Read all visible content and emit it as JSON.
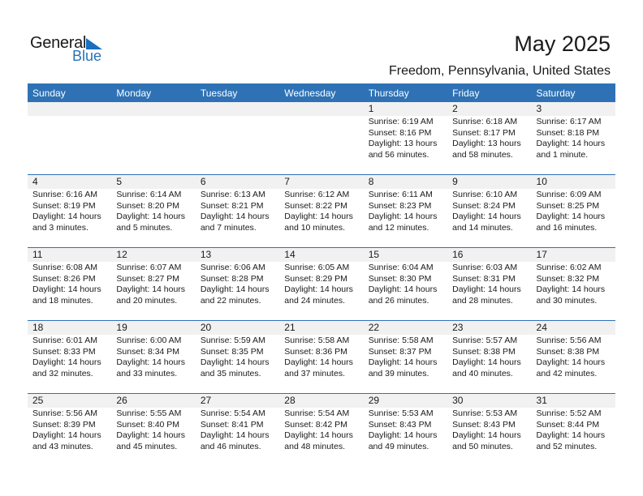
{
  "logo": {
    "word1": "General",
    "word2": "Blue"
  },
  "header": {
    "title": "May 2025",
    "location": "Freedom, Pennsylvania, United States"
  },
  "colors": {
    "header_bg": "#2e72b5",
    "daynum_bg": "#f1f1f1",
    "logo_blue": "#2a72b8"
  },
  "weekdays": [
    "Sunday",
    "Monday",
    "Tuesday",
    "Wednesday",
    "Thursday",
    "Friday",
    "Saturday"
  ],
  "weeks": [
    [
      null,
      null,
      null,
      null,
      {
        "day": "1",
        "sunrise": "Sunrise: 6:19 AM",
        "sunset": "Sunset: 8:16 PM",
        "daylight1": "Daylight: 13 hours",
        "daylight2": "and 56 minutes."
      },
      {
        "day": "2",
        "sunrise": "Sunrise: 6:18 AM",
        "sunset": "Sunset: 8:17 PM",
        "daylight1": "Daylight: 13 hours",
        "daylight2": "and 58 minutes."
      },
      {
        "day": "3",
        "sunrise": "Sunrise: 6:17 AM",
        "sunset": "Sunset: 8:18 PM",
        "daylight1": "Daylight: 14 hours",
        "daylight2": "and 1 minute."
      }
    ],
    [
      {
        "day": "4",
        "sunrise": "Sunrise: 6:16 AM",
        "sunset": "Sunset: 8:19 PM",
        "daylight1": "Daylight: 14 hours",
        "daylight2": "and 3 minutes."
      },
      {
        "day": "5",
        "sunrise": "Sunrise: 6:14 AM",
        "sunset": "Sunset: 8:20 PM",
        "daylight1": "Daylight: 14 hours",
        "daylight2": "and 5 minutes."
      },
      {
        "day": "6",
        "sunrise": "Sunrise: 6:13 AM",
        "sunset": "Sunset: 8:21 PM",
        "daylight1": "Daylight: 14 hours",
        "daylight2": "and 7 minutes."
      },
      {
        "day": "7",
        "sunrise": "Sunrise: 6:12 AM",
        "sunset": "Sunset: 8:22 PM",
        "daylight1": "Daylight: 14 hours",
        "daylight2": "and 10 minutes."
      },
      {
        "day": "8",
        "sunrise": "Sunrise: 6:11 AM",
        "sunset": "Sunset: 8:23 PM",
        "daylight1": "Daylight: 14 hours",
        "daylight2": "and 12 minutes."
      },
      {
        "day": "9",
        "sunrise": "Sunrise: 6:10 AM",
        "sunset": "Sunset: 8:24 PM",
        "daylight1": "Daylight: 14 hours",
        "daylight2": "and 14 minutes."
      },
      {
        "day": "10",
        "sunrise": "Sunrise: 6:09 AM",
        "sunset": "Sunset: 8:25 PM",
        "daylight1": "Daylight: 14 hours",
        "daylight2": "and 16 minutes."
      }
    ],
    [
      {
        "day": "11",
        "sunrise": "Sunrise: 6:08 AM",
        "sunset": "Sunset: 8:26 PM",
        "daylight1": "Daylight: 14 hours",
        "daylight2": "and 18 minutes."
      },
      {
        "day": "12",
        "sunrise": "Sunrise: 6:07 AM",
        "sunset": "Sunset: 8:27 PM",
        "daylight1": "Daylight: 14 hours",
        "daylight2": "and 20 minutes."
      },
      {
        "day": "13",
        "sunrise": "Sunrise: 6:06 AM",
        "sunset": "Sunset: 8:28 PM",
        "daylight1": "Daylight: 14 hours",
        "daylight2": "and 22 minutes."
      },
      {
        "day": "14",
        "sunrise": "Sunrise: 6:05 AM",
        "sunset": "Sunset: 8:29 PM",
        "daylight1": "Daylight: 14 hours",
        "daylight2": "and 24 minutes."
      },
      {
        "day": "15",
        "sunrise": "Sunrise: 6:04 AM",
        "sunset": "Sunset: 8:30 PM",
        "daylight1": "Daylight: 14 hours",
        "daylight2": "and 26 minutes."
      },
      {
        "day": "16",
        "sunrise": "Sunrise: 6:03 AM",
        "sunset": "Sunset: 8:31 PM",
        "daylight1": "Daylight: 14 hours",
        "daylight2": "and 28 minutes."
      },
      {
        "day": "17",
        "sunrise": "Sunrise: 6:02 AM",
        "sunset": "Sunset: 8:32 PM",
        "daylight1": "Daylight: 14 hours",
        "daylight2": "and 30 minutes."
      }
    ],
    [
      {
        "day": "18",
        "sunrise": "Sunrise: 6:01 AM",
        "sunset": "Sunset: 8:33 PM",
        "daylight1": "Daylight: 14 hours",
        "daylight2": "and 32 minutes."
      },
      {
        "day": "19",
        "sunrise": "Sunrise: 6:00 AM",
        "sunset": "Sunset: 8:34 PM",
        "daylight1": "Daylight: 14 hours",
        "daylight2": "and 33 minutes."
      },
      {
        "day": "20",
        "sunrise": "Sunrise: 5:59 AM",
        "sunset": "Sunset: 8:35 PM",
        "daylight1": "Daylight: 14 hours",
        "daylight2": "and 35 minutes."
      },
      {
        "day": "21",
        "sunrise": "Sunrise: 5:58 AM",
        "sunset": "Sunset: 8:36 PM",
        "daylight1": "Daylight: 14 hours",
        "daylight2": "and 37 minutes."
      },
      {
        "day": "22",
        "sunrise": "Sunrise: 5:58 AM",
        "sunset": "Sunset: 8:37 PM",
        "daylight1": "Daylight: 14 hours",
        "daylight2": "and 39 minutes."
      },
      {
        "day": "23",
        "sunrise": "Sunrise: 5:57 AM",
        "sunset": "Sunset: 8:38 PM",
        "daylight1": "Daylight: 14 hours",
        "daylight2": "and 40 minutes."
      },
      {
        "day": "24",
        "sunrise": "Sunrise: 5:56 AM",
        "sunset": "Sunset: 8:38 PM",
        "daylight1": "Daylight: 14 hours",
        "daylight2": "and 42 minutes."
      }
    ],
    [
      {
        "day": "25",
        "sunrise": "Sunrise: 5:56 AM",
        "sunset": "Sunset: 8:39 PM",
        "daylight1": "Daylight: 14 hours",
        "daylight2": "and 43 minutes."
      },
      {
        "day": "26",
        "sunrise": "Sunrise: 5:55 AM",
        "sunset": "Sunset: 8:40 PM",
        "daylight1": "Daylight: 14 hours",
        "daylight2": "and 45 minutes."
      },
      {
        "day": "27",
        "sunrise": "Sunrise: 5:54 AM",
        "sunset": "Sunset: 8:41 PM",
        "daylight1": "Daylight: 14 hours",
        "daylight2": "and 46 minutes."
      },
      {
        "day": "28",
        "sunrise": "Sunrise: 5:54 AM",
        "sunset": "Sunset: 8:42 PM",
        "daylight1": "Daylight: 14 hours",
        "daylight2": "and 48 minutes."
      },
      {
        "day": "29",
        "sunrise": "Sunrise: 5:53 AM",
        "sunset": "Sunset: 8:43 PM",
        "daylight1": "Daylight: 14 hours",
        "daylight2": "and 49 minutes."
      },
      {
        "day": "30",
        "sunrise": "Sunrise: 5:53 AM",
        "sunset": "Sunset: 8:43 PM",
        "daylight1": "Daylight: 14 hours",
        "daylight2": "and 50 minutes."
      },
      {
        "day": "31",
        "sunrise": "Sunrise: 5:52 AM",
        "sunset": "Sunset: 8:44 PM",
        "daylight1": "Daylight: 14 hours",
        "daylight2": "and 52 minutes."
      }
    ]
  ]
}
